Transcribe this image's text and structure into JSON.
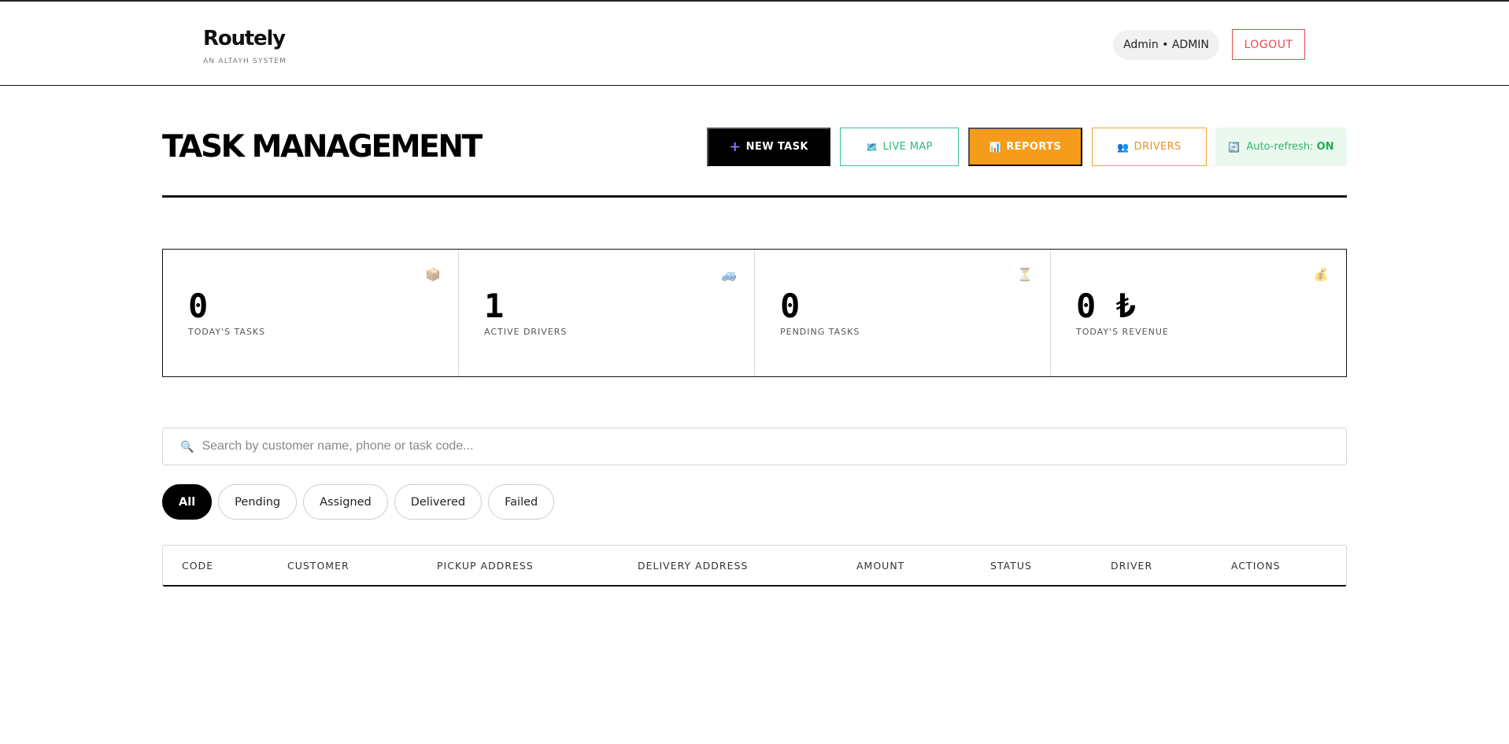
{
  "header": {
    "brand_name": "Routely",
    "brand_sub": "AN ALTAYH SYSTEM",
    "user_label": "Admin • ADMIN",
    "logout_label": "LOGOUT"
  },
  "page": {
    "title": "TASK MANAGEMENT"
  },
  "actions": {
    "new_task": "NEW TASK",
    "live_map": "LIVE MAP",
    "reports": "REPORTS",
    "drivers": "DRIVERS",
    "auto_refresh_label": "Auto-refresh:",
    "auto_refresh_state": "ON"
  },
  "stats": [
    {
      "value": "0",
      "label": "TODAY'S TASKS",
      "icon": "package-icon"
    },
    {
      "value": "1",
      "label": "ACTIVE DRIVERS",
      "icon": "car-icon"
    },
    {
      "value": "0",
      "label": "PENDING TASKS",
      "icon": "hourglass-icon"
    },
    {
      "value": "0 ₺",
      "label": "TODAY'S REVENUE",
      "icon": "money-bag-icon"
    }
  ],
  "search": {
    "placeholder": "Search by customer name, phone or task code..."
  },
  "filters": [
    "All",
    "Pending",
    "Assigned",
    "Delivered",
    "Failed"
  ],
  "active_filter": "All",
  "table": {
    "columns": [
      "CODE",
      "CUSTOMER",
      "PICKUP ADDRESS",
      "DELIVERY ADDRESS",
      "AMOUNT",
      "STATUS",
      "DRIVER",
      "ACTIONS"
    ]
  },
  "colors": {
    "accent_orange": "#f59c1a",
    "accent_green": "#2fb87e",
    "danger_red": "#e54b4b",
    "primary_black": "#000000"
  }
}
